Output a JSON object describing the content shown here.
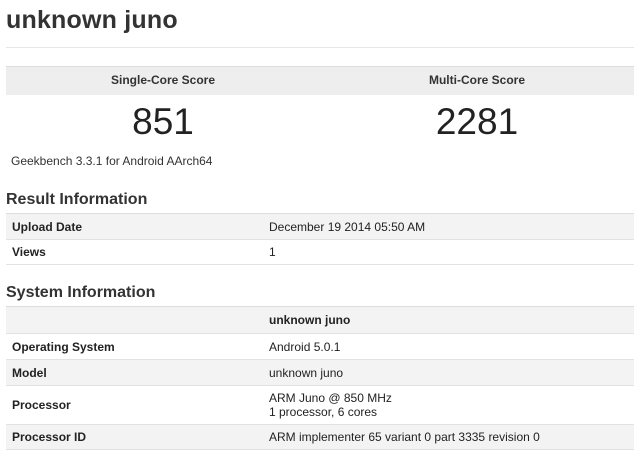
{
  "page": {
    "title": "unknown juno"
  },
  "scores": {
    "single_label": "Single-Core Score",
    "single_value": "851",
    "multi_label": "Multi-Core Score",
    "multi_value": "2281",
    "version": "Geekbench 3.3.1 for Android AArch64"
  },
  "result_info": {
    "title": "Result Information",
    "rows": [
      {
        "key": "Upload Date",
        "value": "December 19 2014 05:50 AM"
      },
      {
        "key": "Views",
        "value": "1"
      }
    ]
  },
  "system_info": {
    "title": "System Information",
    "header": "unknown juno",
    "rows": [
      {
        "key": "Operating System",
        "value": "Android 5.0.1"
      },
      {
        "key": "Model",
        "value": "unknown juno"
      },
      {
        "key": "Processor",
        "value": "ARM Juno @ 850 MHz",
        "value2": "1 processor, 6 cores"
      },
      {
        "key": "Processor ID",
        "value": "ARM implementer 65 variant 0 part 3335 revision 0"
      }
    ]
  },
  "colors": {
    "header_bg": "#eeeeee",
    "row_shade": "#f3f3f3",
    "border": "#e2e2e2",
    "text": "#222222"
  }
}
